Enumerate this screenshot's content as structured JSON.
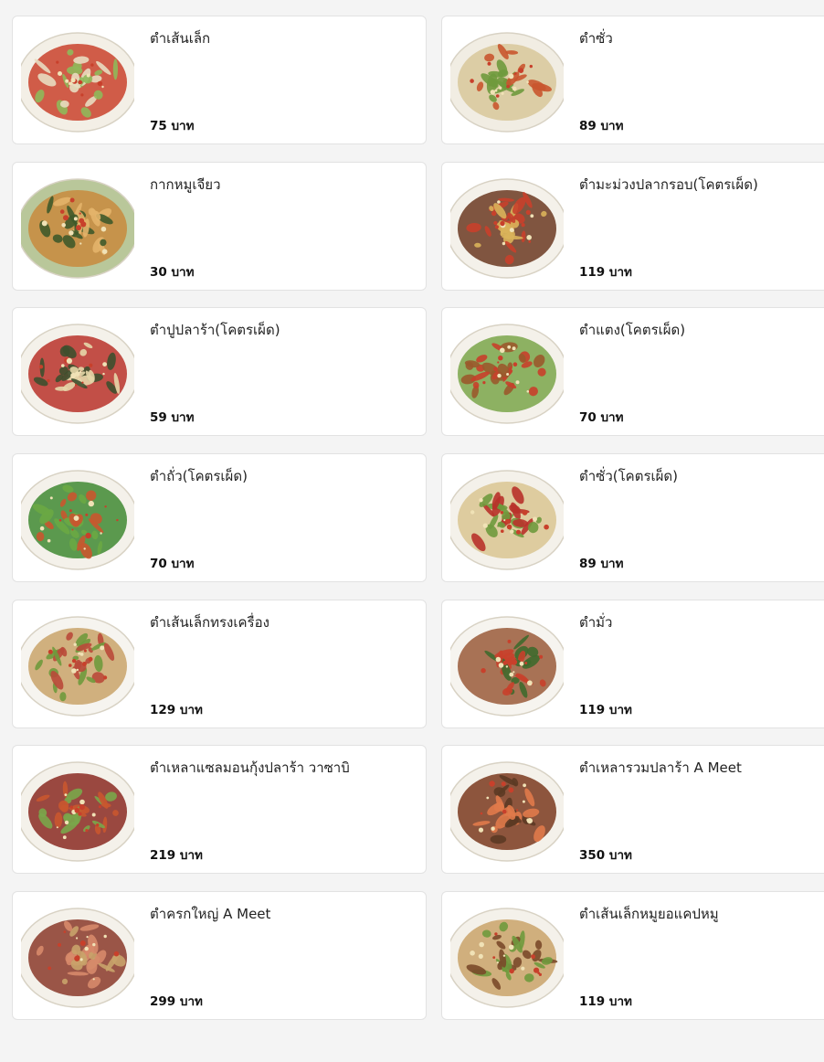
{
  "colors": {
    "background": "#f4f4f4",
    "card": "#ffffff",
    "border": "#e2e2e2",
    "text": "#222222"
  },
  "menu": {
    "items": [
      {
        "name": "ตำเส้นเล็ก",
        "price": "75 บาท",
        "icon": "som-tam-noodle-photo",
        "palette": [
          "#f3efe6",
          "#c9422b",
          "#8fb85a",
          "#e8dcc0"
        ]
      },
      {
        "name": "ตำซั่ว",
        "price": "89 บาท",
        "icon": "som-tam-sua-photo",
        "palette": [
          "#f1ede3",
          "#d8c79a",
          "#c9562f",
          "#6f9a3d"
        ]
      },
      {
        "name": "กากหมูเจียว",
        "price": "30 บาท",
        "icon": "crispy-pork-photo",
        "palette": [
          "#b9c79a",
          "#c8893d",
          "#e3b46a",
          "#3f5a2a"
        ]
      },
      {
        "name": "ตำมะม่วงปลากรอบ(โคตรเผ็ด)",
        "price": "119 บาท",
        "icon": "mango-salad-photo",
        "palette": [
          "#f4f1ea",
          "#6b3a22",
          "#c8402b",
          "#d9b25a"
        ]
      },
      {
        "name": "ตำปูปลาร้า(โคตรเผ็ด)",
        "price": "59 บาท",
        "icon": "crab-salad-photo",
        "palette": [
          "#f4f1ea",
          "#b8322a",
          "#e6d6a8",
          "#3e4f2e"
        ]
      },
      {
        "name": "ตำแตง(โคตรเผ็ด)",
        "price": "70 บาท",
        "icon": "cucumber-salad-photo",
        "palette": [
          "#f4f1ea",
          "#7aa64a",
          "#9a5a2c",
          "#c8402b"
        ]
      },
      {
        "name": "ตำถั่ว(โคตรเผ็ด)",
        "price": "70 บาท",
        "icon": "bean-salad-photo",
        "palette": [
          "#f4f1ea",
          "#3f8a32",
          "#c9562f",
          "#6aa844"
        ]
      },
      {
        "name": "ตำซั่ว(โคตรเผ็ด)",
        "price": "89 บาท",
        "icon": "spicy-som-tam-sua-photo",
        "palette": [
          "#f4f1ea",
          "#d9c592",
          "#b8322a",
          "#6f9a3d"
        ]
      },
      {
        "name": "ตำเส้นเล็กทรงเครื่อง",
        "price": "129 บาท",
        "icon": "deluxe-noodle-salad-photo",
        "palette": [
          "#f6f4ef",
          "#c9a36a",
          "#b94a3a",
          "#6f9a3d"
        ]
      },
      {
        "name": "ตำมั่ว",
        "price": "119 บาท",
        "icon": "mixed-salad-photo",
        "palette": [
          "#f6f4ef",
          "#9a5a3a",
          "#3f6a2e",
          "#c8402b"
        ]
      },
      {
        "name": "ตำเหลาแซลมอนกุ้งปลาร้า วาซาบิ",
        "price": "219 บาท",
        "icon": "salmon-shrimp-salad-photo",
        "palette": [
          "#f4f1ea",
          "#8a2a22",
          "#c9562f",
          "#7aa64a"
        ]
      },
      {
        "name": "ตำเหลารวมปลาร้า A Meet",
        "price": "350 บาท",
        "icon": "seafood-mix-salad-photo",
        "palette": [
          "#f4f1ea",
          "#7a3a1e",
          "#e07a4a",
          "#5c3a24"
        ]
      },
      {
        "name": "ตำครกใหญ่ A Meet",
        "price": "299 บาท",
        "icon": "big-mortar-salad-photo",
        "palette": [
          "#f4f1ea",
          "#8a3a2a",
          "#d78a6a",
          "#c9a36a"
        ]
      },
      {
        "name": "ตำเส้นเล็กหมูยอแคปหมู",
        "price": "119 บาท",
        "icon": "pork-sausage-noodle-salad-photo",
        "palette": [
          "#f4f1ea",
          "#c9a36a",
          "#7a4a2a",
          "#6f9a3d"
        ]
      }
    ]
  }
}
